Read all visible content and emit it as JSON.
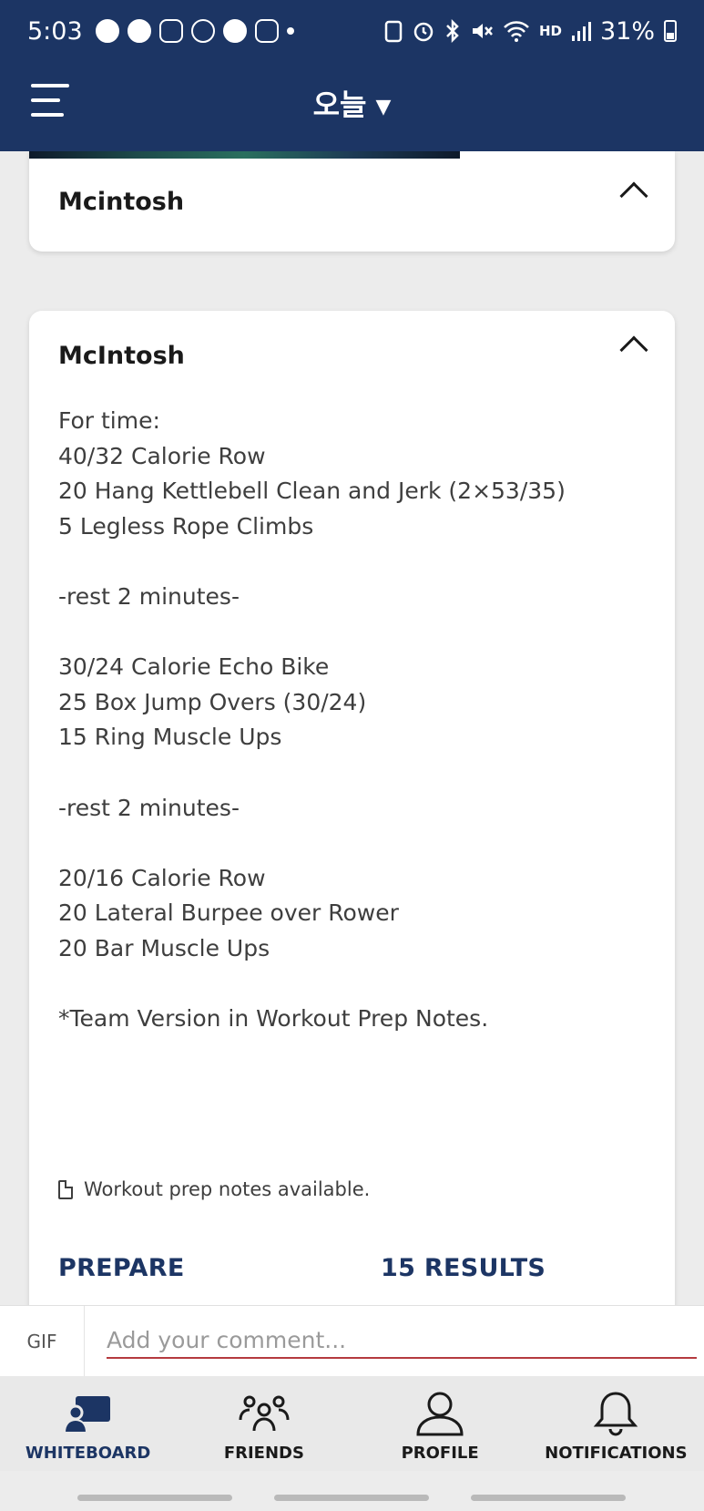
{
  "status_bar": {
    "time": "5:03",
    "battery": "31%",
    "network_label": "HD"
  },
  "app_bar": {
    "title": "오늘",
    "caret": "▼"
  },
  "cards": [
    {
      "title": "Mcintosh"
    },
    {
      "title": "McIntosh",
      "workout_text": "For time:\n40/32 Calorie Row\n20 Hang Kettlebell Clean and Jerk (2×53/35)\n5 Legless Rope Climbs\n\n-rest 2 minutes-\n\n30/24 Calorie Echo Bike\n25 Box Jump Overs (30/24)\n15 Ring Muscle Ups\n\n-rest 2 minutes-\n\n20/16 Calorie Row\n20 Lateral Burpee over Rower\n20 Bar Muscle Ups\n\n*Team Version in Workout Prep Notes.",
      "prep_note": "Workout prep notes available.",
      "prepare_label": "PREPARE",
      "results_label": "15 RESULTS"
    }
  ],
  "comment": {
    "gif_label": "GIF",
    "placeholder": "Add your comment..."
  },
  "bottom_nav": [
    {
      "label": "WHITEBOARD",
      "icon": "whiteboard-icon",
      "active": true
    },
    {
      "label": "FRIENDS",
      "icon": "friends-icon",
      "active": false
    },
    {
      "label": "PROFILE",
      "icon": "profile-icon",
      "active": false
    },
    {
      "label": "NOTIFICATIONS",
      "icon": "bell-icon",
      "active": false
    }
  ],
  "colors": {
    "primary": "#1c3564",
    "accent_red": "#c1272d",
    "background": "#ececec"
  }
}
